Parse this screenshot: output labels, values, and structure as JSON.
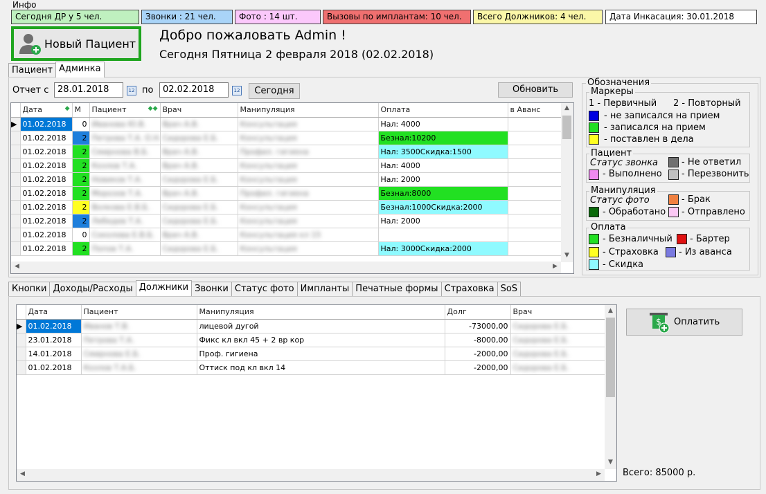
{
  "info": {
    "label": "Инфо",
    "chips": [
      {
        "text": "Сегодня ДР у 5 чел.",
        "color": "#bff0bf"
      },
      {
        "text": "Звонки : 21 чел.",
        "color": "#a9d4f8"
      },
      {
        "text": "Фото : 14 шт.",
        "color": "#fbc8fb"
      },
      {
        "text": "Вызовы по имплантам: 10 чел.",
        "color": "#f07070"
      },
      {
        "text": "Всего Должников: 4 чел.",
        "color": "#fbf7a8"
      },
      {
        "text": "Дата Инкасация: 30.01.2018",
        "color": "#ffffff"
      }
    ]
  },
  "header": {
    "new_patient": "Новый Пациент",
    "welcome": "Добро пожаловать Admin !",
    "today": "Сегодня Пятница 2 февраля 2018 (02.02.2018)"
  },
  "top_tabs": [
    "Пациент",
    "Админка"
  ],
  "report": {
    "from_label": "Отчет с",
    "from_value": "28.01.2018",
    "to_label": "по",
    "to_value": "02.02.2018",
    "today_btn": "Сегодня",
    "refresh_btn": "Обновить",
    "columns": [
      "Дата",
      "М",
      "Пациент",
      "Врач",
      "Манипуляция",
      "Оплата",
      "в Аванс"
    ],
    "rows": [
      {
        "date": "01.02.2018",
        "m": "0",
        "m_color": "#ffffff",
        "patient": "Иванова Ю.В.",
        "doctor": "Врач А.В.",
        "manip": "Консультация",
        "pay": "Нал: 4000",
        "pay_color": "#ffffff"
      },
      {
        "date": "01.02.2018",
        "m": "2",
        "m_color": "#1e7fdc",
        "patient": "Петрова Т.А. О.Н.",
        "doctor": "Сидорова Е.Б.",
        "manip": "Консультация",
        "pay": "Безнал:10200",
        "pay_color": "#22e022"
      },
      {
        "date": "01.02.2018",
        "m": "2",
        "m_color": "#22e022",
        "patient": "Смирнова В.Б.",
        "doctor": "Врач А.В.",
        "manip": "Профил. гигиена",
        "pay": "Нал: 3500Скидка:1500",
        "pay_color": "#8ffaff"
      },
      {
        "date": "01.02.2018",
        "m": "2",
        "m_color": "#22e022",
        "patient": "Козлов Т.А.",
        "doctor": "Врач А.В.",
        "manip": "Консультация",
        "pay": "Нал: 4000",
        "pay_color": "#ffffff"
      },
      {
        "date": "01.02.2018",
        "m": "2",
        "m_color": "#22e022",
        "patient": "Новиков Т.А.",
        "doctor": "Сидорова Е.Б.",
        "manip": "Консультация",
        "pay": "Нал: 2000",
        "pay_color": "#ffffff"
      },
      {
        "date": "01.02.2018",
        "m": "2",
        "m_color": "#22e022",
        "patient": "Морозов Т.А.",
        "doctor": "Врач А.В.",
        "manip": "Профил. гигиена",
        "pay": "Безнал:8000",
        "pay_color": "#22e022"
      },
      {
        "date": "01.02.2018",
        "m": "2",
        "m_color": "#ffff22",
        "patient": "Волкова Е.В.Б.",
        "doctor": "Сидорова Е.Б.",
        "manip": "Консультация",
        "pay": "Безнал:1000Скидка:2000",
        "pay_color": "#8ffaff"
      },
      {
        "date": "01.02.2018",
        "m": "2",
        "m_color": "#1e7fdc",
        "patient": "Лебедев Т.А.",
        "doctor": "Сидорова Е.Б.",
        "manip": "Консультация",
        "pay": "Нал: 2000",
        "pay_color": "#ffffff"
      },
      {
        "date": "01.02.2018",
        "m": "0",
        "m_color": "#ffffff",
        "patient": "Соколова Е.В.Б.",
        "doctor": "Врач А.В.",
        "manip": "Консультация кл 15",
        "pay": "",
        "pay_color": "#ffffff"
      },
      {
        "date": "01.02.2018",
        "m": "2",
        "m_color": "#22e022",
        "patient": "Попов Т.А.",
        "doctor": "Сидорова Е.Б.",
        "manip": "Консультация",
        "pay": "Нал: 3000Скидка:2000",
        "pay_color": "#8ffaff"
      }
    ]
  },
  "legend": {
    "title": "Обозначения",
    "markers_title": "Маркеры",
    "primary": "1 - Первичный",
    "repeat": "2 - Повторный",
    "markers": [
      {
        "color": "#0000e0",
        "text": "- не записался на прием"
      },
      {
        "color": "#22e022",
        "text": "- записался на прием"
      },
      {
        "color": "#ffff22",
        "text": "- поставлен в дела"
      }
    ],
    "patient_title": "Пациент",
    "call_status": "Статус звонка",
    "no_answer": "- Не ответил",
    "no_answer_color": "#707070",
    "done": "- Выполнено",
    "done_color": "#f08af0",
    "recall": "- Перезвонить",
    "recall_color": "#c0c0c0",
    "manip_title": "Манипуляция",
    "photo_status": "Статус фото",
    "defect": "- Брак",
    "defect_color": "#f08040",
    "processed": "- Обработано",
    "processed_color": "#0a6a0a",
    "sent": "- Отправлено",
    "sent_color": "#fbc8f4",
    "payment_title": "Оплата",
    "cashless": "- Безналичный",
    "cashless_color": "#22e022",
    "barter": "- Бартер",
    "barter_color": "#e01010",
    "insurance": "- Страховка",
    "insurance_color": "#ffff22",
    "advance": "- Из аванса",
    "advance_color": "#7a7ae0",
    "discount": "- Скидка",
    "discount_color": "#8ffaff"
  },
  "bottom_tabs": [
    "Кнопки",
    "Доходы/Расходы",
    "Должники",
    "Звонки",
    "Статус фото",
    "Импланты",
    "Печатные формы",
    "Страховка",
    "SoS"
  ],
  "debtors": {
    "columns": [
      "Дата",
      "Пациент",
      "Манипуляция",
      "Долг",
      "Врач"
    ],
    "rows": [
      {
        "date": "01.02.2018",
        "patient": "Иванов Т.В.",
        "manip": "лицевой дугой",
        "debt": "-73000,00",
        "doctor": "Сидорова Е.Б."
      },
      {
        "date": "23.01.2018",
        "patient": "Петрова Т.А.",
        "manip": "Фикс кл вкл 45 + 2 вр кор",
        "debt": "-8000,00",
        "doctor": "Сидорова Е.Б."
      },
      {
        "date": "14.01.2018",
        "patient": "Смирнова Е.Б.",
        "manip": "Проф. гигиена",
        "debt": "-2000,00",
        "doctor": "Сидорова Е.Б."
      },
      {
        "date": "01.02.2018",
        "patient": "Козлов Т.А.Б.",
        "manip": "Оттиск под кл вкл 14",
        "debt": "-2000,00",
        "doctor": "Сидорова Е.Б."
      }
    ],
    "pay_btn": "Оплатить",
    "total": "Всего: 85000 р."
  }
}
